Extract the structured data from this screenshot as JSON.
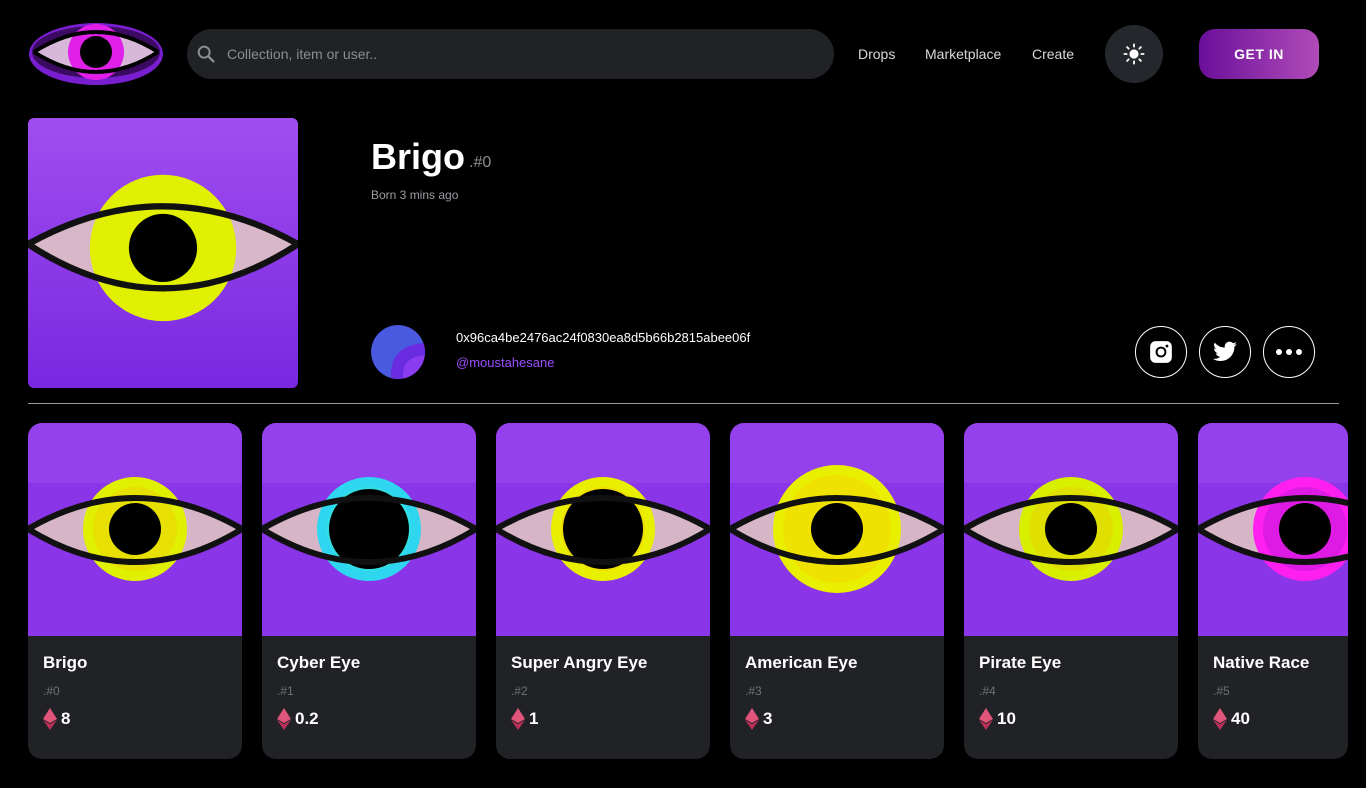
{
  "header": {
    "search_placeholder": "Collection, item or user..",
    "nav": [
      "Drops",
      "Marketplace",
      "Create"
    ],
    "cta": "GET IN"
  },
  "profile": {
    "name": "Brigo",
    "id": ".#0",
    "born": "Born 3 mins ago",
    "owner_address": "0x96ca4be2476ac24f0830ea8d5b66b2815abee06f",
    "owner_handle": "@moustahesane"
  },
  "colors": {
    "accent": "#9b4dff",
    "card_bg": "#202226",
    "purple_bg": "#8b35e8"
  },
  "items": [
    {
      "title": "Brigo",
      "id": ".#0",
      "price": "8",
      "iris": "#e0f000",
      "iris2": "#f4c400"
    },
    {
      "title": "Cyber Eye",
      "id": ".#1",
      "price": "0.2",
      "iris": "#2fd6f0",
      "iris2": "#38f0c8"
    },
    {
      "title": "Super Angry Eye",
      "id": ".#2",
      "price": "1",
      "iris": "#e8f000",
      "iris2": "#ffc400"
    },
    {
      "title": "American Eye",
      "id": ".#3",
      "price": "3",
      "iris": "#e8f000",
      "iris2": "#ffc800"
    },
    {
      "title": "Pirate Eye",
      "id": ".#4",
      "price": "10",
      "iris": "#d8f000",
      "iris2": "#f0c400"
    },
    {
      "title": "Native Race",
      "id": ".#5",
      "price": "40",
      "iris": "#ff20f0",
      "iris2": "#a010d0"
    }
  ]
}
